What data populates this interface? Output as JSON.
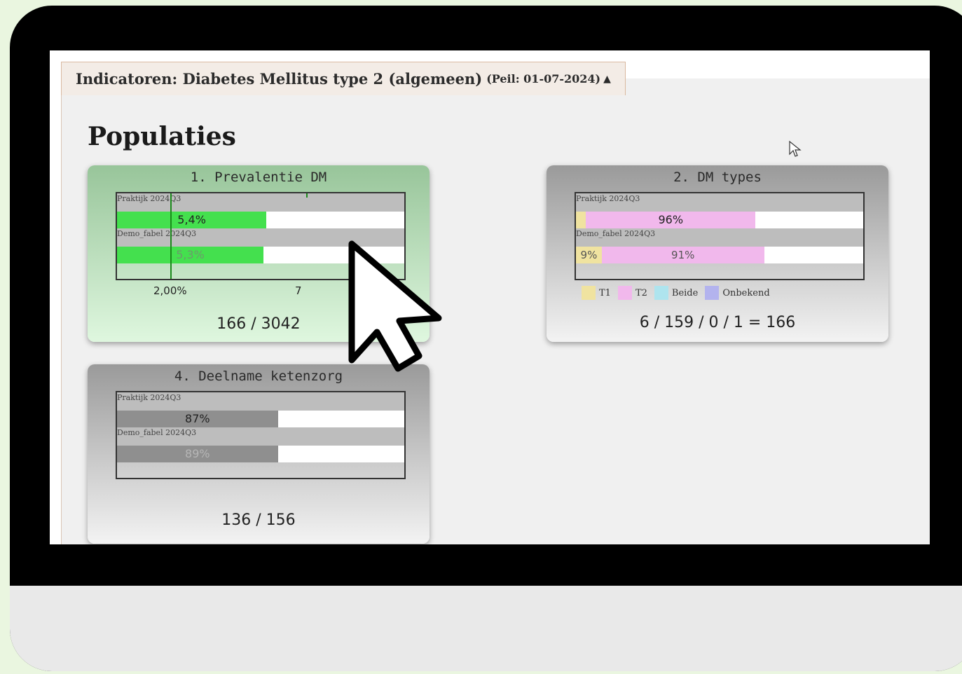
{
  "panel": {
    "title": "Indicatoren: Diabetes Mellitus type 2 (algemeen)",
    "peil": "(Peil: 01-07-2024)",
    "caret": "▲"
  },
  "heading": "Populaties",
  "colors": {
    "green_bar": "#44e04e",
    "grey_bar": "#8f8f8f",
    "t1": "#f0e3a0",
    "t2": "#f1b8ec",
    "beide": "#aee4ee",
    "onbekend": "#b3b3ee"
  },
  "cards": [
    {
      "title": "1. Prevalentie DM",
      "rows": [
        {
          "label": "Praktijk 2024Q3",
          "value_text": "5,4%",
          "fraction": 0.52
        },
        {
          "label": "Demo_fabel 2024Q3",
          "value_text": "5,3%",
          "fraction": 0.51
        }
      ],
      "ticks": [
        "2,00%",
        "7"
      ],
      "footer": "166 / 3042"
    },
    {
      "title": "2. DM types",
      "rows": [
        {
          "label": "Praktijk 2024Q3",
          "segments": [
            {
              "type": "T1",
              "fraction": 0.035,
              "label": ""
            },
            {
              "type": "T2",
              "fraction": 0.59,
              "label": "96%"
            }
          ]
        },
        {
          "label": "Demo_fabel 2024Q3",
          "segments": [
            {
              "type": "T1",
              "fraction": 0.09,
              "label": "9%"
            },
            {
              "type": "T2",
              "fraction": 0.565,
              "label": "91%"
            }
          ]
        }
      ],
      "legend": [
        {
          "name": "T1",
          "color": "#f0e3a0"
        },
        {
          "name": "T2",
          "color": "#f1b8ec"
        },
        {
          "name": "Beide",
          "color": "#aee4ee"
        },
        {
          "name": "Onbekend",
          "color": "#b3b3ee"
        }
      ],
      "footer": "6 / 159 / 0 / 1 = 166"
    },
    {
      "title": "4. Deelname ketenzorg",
      "rows": [
        {
          "label": "Praktijk 2024Q3",
          "value_text": "87%",
          "fraction": 0.56
        },
        {
          "label": "Demo_fabel 2024Q3",
          "value_text": "89%",
          "fraction": 0.56
        }
      ],
      "footer": "136 / 156"
    }
  ]
}
